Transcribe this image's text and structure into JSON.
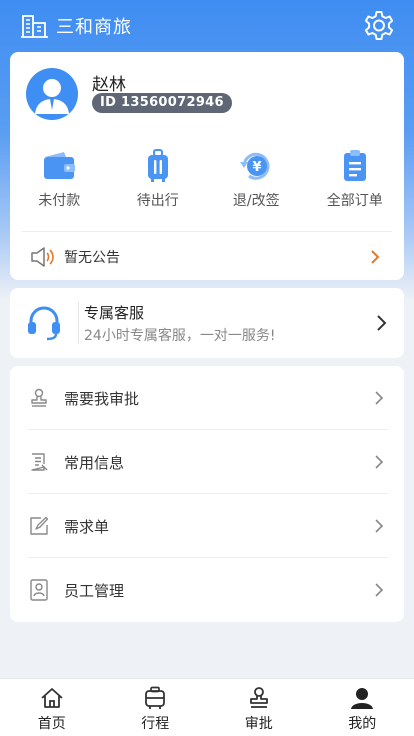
{
  "header": {
    "brand": "三和商旅",
    "settings_icon": "gear-icon"
  },
  "profile": {
    "name": "赵林",
    "id_label": "ID 13560072946"
  },
  "quick_actions": [
    {
      "label": "未付款",
      "icon": "wallet-icon"
    },
    {
      "label": "待出行",
      "icon": "luggage-icon"
    },
    {
      "label": "退/改签",
      "icon": "refund-icon"
    },
    {
      "label": "全部订单",
      "icon": "order-list-icon"
    }
  ],
  "notice": {
    "text": "暂无公告",
    "icon": "speaker-icon"
  },
  "service": {
    "title": "专属客服",
    "subtitle": "24小时专属客服，一对一服务!"
  },
  "menu": [
    {
      "label": "需要我审批",
      "icon": "stamp-icon"
    },
    {
      "label": "常用信息",
      "icon": "document-icon"
    },
    {
      "label": "需求单",
      "icon": "edit-icon"
    },
    {
      "label": "员工管理",
      "icon": "employee-card-icon"
    }
  ],
  "tabs": [
    {
      "label": "首页",
      "icon": "home-icon"
    },
    {
      "label": "行程",
      "icon": "trip-icon"
    },
    {
      "label": "审批",
      "icon": "approval-icon"
    },
    {
      "label": "我的",
      "icon": "profile-icon"
    }
  ],
  "colors": {
    "brand_blue": "#3e8ef3",
    "notice_orange": "#e07a2c",
    "badge_gray": "#5f6675"
  }
}
